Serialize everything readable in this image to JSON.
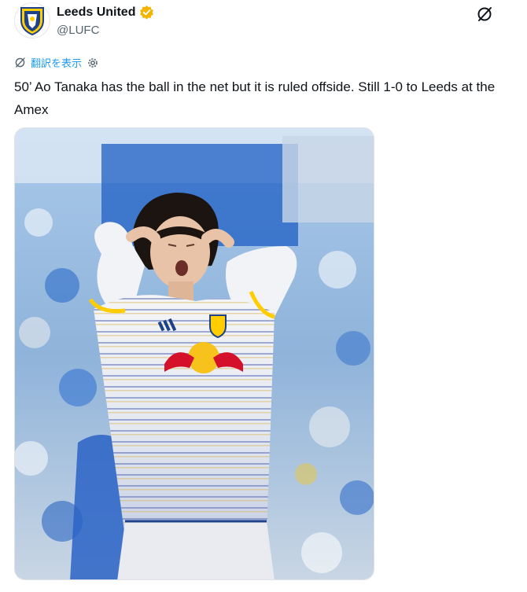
{
  "account": {
    "display_name": "Leeds United",
    "handle": "@LUFC",
    "verified": true,
    "verified_badge_color": "#f4b400"
  },
  "post": {
    "translate_label": "翻訳を表示",
    "text": "50’ Ao Tanaka has the ball in the net but it is ruled offside. Still 1-0 to Leeds at the Amex"
  },
  "icons": {
    "grok": "grok-icon",
    "translate": "translate-icon",
    "settings": "gear-icon"
  },
  "colors": {
    "link": "#1d9bf0",
    "text": "#0f1419",
    "secondary": "#536471",
    "leeds_yellow": "#ffcd00",
    "leeds_blue": "#1d428a"
  }
}
